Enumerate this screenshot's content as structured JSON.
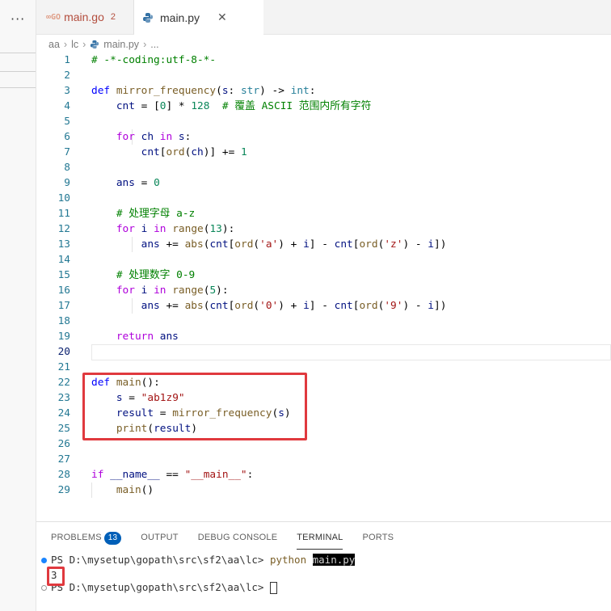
{
  "window": {
    "more_actions": "···"
  },
  "tabs": [
    {
      "label": "main.go",
      "icon": "go-icon",
      "problems": "2"
    },
    {
      "label": "main.py",
      "icon": "python-icon",
      "close": "✕"
    }
  ],
  "breadcrumb": {
    "parts": [
      "aa",
      "lc",
      "main.py",
      "..."
    ]
  },
  "code_lines": [
    [
      [
        "cm",
        "# -*-coding:utf-8-*-"
      ]
    ],
    [],
    [
      [
        "kw",
        "def "
      ],
      [
        "fn",
        "mirror_frequency"
      ],
      [
        "op",
        "("
      ],
      [
        "tx",
        "s"
      ],
      [
        "op",
        ": "
      ],
      [
        "ty",
        "str"
      ],
      [
        "op",
        ") -> "
      ],
      [
        "ty",
        "int"
      ],
      [
        "op",
        ":"
      ]
    ],
    [
      [
        "op",
        "    "
      ],
      [
        "tx",
        "cnt"
      ],
      [
        "op",
        " = ["
      ],
      [
        "num",
        "0"
      ],
      [
        "op",
        "] * "
      ],
      [
        "num",
        "128"
      ],
      [
        "op",
        "  "
      ],
      [
        "cm",
        "# 覆盖 ASCII 范围内所有字符"
      ]
    ],
    [],
    [
      [
        "op",
        "    "
      ],
      [
        "ctl",
        "for "
      ],
      [
        "tx",
        "ch"
      ],
      [
        "ctl",
        " in "
      ],
      [
        "tx",
        "s"
      ],
      [
        "op",
        ":"
      ]
    ],
    [
      [
        "op",
        "        "
      ],
      [
        "tx",
        "cnt"
      ],
      [
        "op",
        "["
      ],
      [
        "fn",
        "ord"
      ],
      [
        "op",
        "("
      ],
      [
        "tx",
        "ch"
      ],
      [
        "op",
        ")] += "
      ],
      [
        "num",
        "1"
      ]
    ],
    [],
    [
      [
        "op",
        "    "
      ],
      [
        "tx",
        "ans"
      ],
      [
        "op",
        " = "
      ],
      [
        "num",
        "0"
      ]
    ],
    [],
    [
      [
        "op",
        "    "
      ],
      [
        "cm",
        "# 处理字母 a-z"
      ]
    ],
    [
      [
        "op",
        "    "
      ],
      [
        "ctl",
        "for "
      ],
      [
        "tx",
        "i"
      ],
      [
        "ctl",
        " in "
      ],
      [
        "fn",
        "range"
      ],
      [
        "op",
        "("
      ],
      [
        "num",
        "13"
      ],
      [
        "op",
        "):"
      ]
    ],
    [
      [
        "op",
        "        "
      ],
      [
        "tx",
        "ans"
      ],
      [
        "op",
        " += "
      ],
      [
        "fn",
        "abs"
      ],
      [
        "op",
        "("
      ],
      [
        "tx",
        "cnt"
      ],
      [
        "op",
        "["
      ],
      [
        "fn",
        "ord"
      ],
      [
        "op",
        "("
      ],
      [
        "str",
        "'a'"
      ],
      [
        "op",
        ") + "
      ],
      [
        "tx",
        "i"
      ],
      [
        "op",
        "] - "
      ],
      [
        "tx",
        "cnt"
      ],
      [
        "op",
        "["
      ],
      [
        "fn",
        "ord"
      ],
      [
        "op",
        "("
      ],
      [
        "str",
        "'z'"
      ],
      [
        "op",
        ") - "
      ],
      [
        "tx",
        "i"
      ],
      [
        "op",
        "])"
      ]
    ],
    [],
    [
      [
        "op",
        "    "
      ],
      [
        "cm",
        "# 处理数字 0-9"
      ]
    ],
    [
      [
        "op",
        "    "
      ],
      [
        "ctl",
        "for "
      ],
      [
        "tx",
        "i"
      ],
      [
        "ctl",
        " in "
      ],
      [
        "fn",
        "range"
      ],
      [
        "op",
        "("
      ],
      [
        "num",
        "5"
      ],
      [
        "op",
        "):"
      ]
    ],
    [
      [
        "op",
        "        "
      ],
      [
        "tx",
        "ans"
      ],
      [
        "op",
        " += "
      ],
      [
        "fn",
        "abs"
      ],
      [
        "op",
        "("
      ],
      [
        "tx",
        "cnt"
      ],
      [
        "op",
        "["
      ],
      [
        "fn",
        "ord"
      ],
      [
        "op",
        "("
      ],
      [
        "str",
        "'0'"
      ],
      [
        "op",
        ") + "
      ],
      [
        "tx",
        "i"
      ],
      [
        "op",
        "] - "
      ],
      [
        "tx",
        "cnt"
      ],
      [
        "op",
        "["
      ],
      [
        "fn",
        "ord"
      ],
      [
        "op",
        "("
      ],
      [
        "str",
        "'9'"
      ],
      [
        "op",
        ") - "
      ],
      [
        "tx",
        "i"
      ],
      [
        "op",
        "])"
      ]
    ],
    [],
    [
      [
        "op",
        "    "
      ],
      [
        "ctl",
        "return "
      ],
      [
        "tx",
        "ans"
      ]
    ],
    [],
    [],
    [
      [
        "kw",
        "def "
      ],
      [
        "fn",
        "main"
      ],
      [
        "op",
        "():"
      ]
    ],
    [
      [
        "op",
        "    "
      ],
      [
        "tx",
        "s"
      ],
      [
        "op",
        " = "
      ],
      [
        "str",
        "\"ab1z9\""
      ]
    ],
    [
      [
        "op",
        "    "
      ],
      [
        "tx",
        "result"
      ],
      [
        "op",
        " = "
      ],
      [
        "fn",
        "mirror_frequency"
      ],
      [
        "op",
        "("
      ],
      [
        "tx",
        "s"
      ],
      [
        "op",
        ")"
      ]
    ],
    [
      [
        "op",
        "    "
      ],
      [
        "fn",
        "print"
      ],
      [
        "op",
        "("
      ],
      [
        "tx",
        "result"
      ],
      [
        "op",
        ")"
      ]
    ],
    [],
    [],
    [
      [
        "ctl",
        "if "
      ],
      [
        "tx",
        "__name__"
      ],
      [
        "op",
        " == "
      ],
      [
        "str",
        "\"__main__\""
      ],
      [
        "op",
        ":"
      ]
    ],
    [
      [
        "op",
        "    "
      ],
      [
        "fn",
        "main"
      ],
      [
        "op",
        "()"
      ]
    ]
  ],
  "current_line": 20,
  "panel": {
    "tabs": [
      {
        "label": "PROBLEMS",
        "badge": "13"
      },
      {
        "label": "OUTPUT"
      },
      {
        "label": "DEBUG CONSOLE"
      },
      {
        "label": "TERMINAL",
        "active": true
      },
      {
        "label": "PORTS"
      }
    ]
  },
  "terminal": {
    "line1_prompt": "PS D:\\mysetup\\gopath\\src\\sf2\\aa\\lc> ",
    "line1_cmd": "python",
    "line1_space": " ",
    "line1_arg": "main.py",
    "line2_output": "3",
    "line3_prompt": "PS D:\\mysetup\\gopath\\src\\sf2\\aa\\lc> "
  },
  "colors": {
    "highlight_box": "#e0393e",
    "accent": "#005fb8"
  }
}
